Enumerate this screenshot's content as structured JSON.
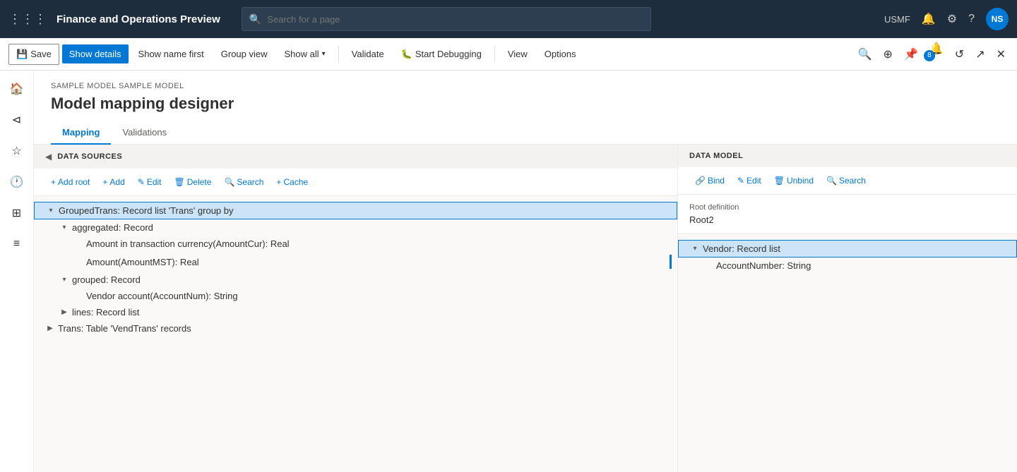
{
  "app": {
    "title": "Finance and Operations Preview",
    "search_placeholder": "Search for a page",
    "user": "USMF",
    "avatar_initials": "NS"
  },
  "toolbar": {
    "save_label": "Save",
    "show_details_label": "Show details",
    "show_name_label": "Show name first",
    "group_view_label": "Group view",
    "show_all_label": "Show all",
    "validate_label": "Validate",
    "start_debugging_label": "Start Debugging",
    "view_label": "View",
    "options_label": "Options"
  },
  "sidebar": {
    "icons": [
      "home",
      "star",
      "clock",
      "calendar",
      "list"
    ]
  },
  "page": {
    "breadcrumb": "SAMPLE MODEL SAMPLE MODEL",
    "title": "Model mapping designer"
  },
  "tabs": {
    "items": [
      {
        "label": "Mapping",
        "active": true
      },
      {
        "label": "Validations",
        "active": false
      }
    ]
  },
  "data_sources": {
    "header": "DATA SOURCES",
    "toolbar": {
      "add_root": "+ Add root",
      "add": "+ Add",
      "edit": "✎ Edit",
      "delete": "🗑 Delete",
      "search": "🔍 Search",
      "cache": "+ Cache"
    },
    "tree": [
      {
        "level": 1,
        "label": "GroupedTrans: Record list 'Trans' group by",
        "expanded": true,
        "selected": true,
        "has_binding": false
      },
      {
        "level": 2,
        "label": "aggregated: Record",
        "expanded": true,
        "selected": false,
        "has_binding": false
      },
      {
        "level": 3,
        "label": "Amount in transaction currency(AmountCur): Real",
        "expanded": false,
        "selected": false,
        "has_binding": false
      },
      {
        "level": 3,
        "label": "Amount(AmountMST): Real",
        "expanded": false,
        "selected": false,
        "has_binding": true
      },
      {
        "level": 2,
        "label": "grouped: Record",
        "expanded": true,
        "selected": false,
        "has_binding": false
      },
      {
        "level": 3,
        "label": "Vendor account(AccountNum): String",
        "expanded": false,
        "selected": false,
        "has_binding": false
      },
      {
        "level": 2,
        "label": "lines: Record list",
        "expanded": false,
        "selected": false,
        "has_binding": false,
        "collapsed": true
      },
      {
        "level": 1,
        "label": "Trans: Table 'VendTrans' records",
        "expanded": false,
        "selected": false,
        "has_binding": false,
        "collapsed": true
      }
    ]
  },
  "data_model": {
    "header": "DATA MODEL",
    "toolbar": {
      "bind": "🔗 Bind",
      "edit": "✎ Edit",
      "unbind": "🗑 Unbind",
      "search": "🔍 Search"
    },
    "root_definition_label": "Root definition",
    "root_definition_value": "Root2",
    "tree": [
      {
        "level": 1,
        "label": "Vendor: Record list",
        "expanded": true,
        "selected": true
      },
      {
        "level": 2,
        "label": "AccountNumber: String",
        "expanded": false,
        "selected": false
      }
    ]
  }
}
